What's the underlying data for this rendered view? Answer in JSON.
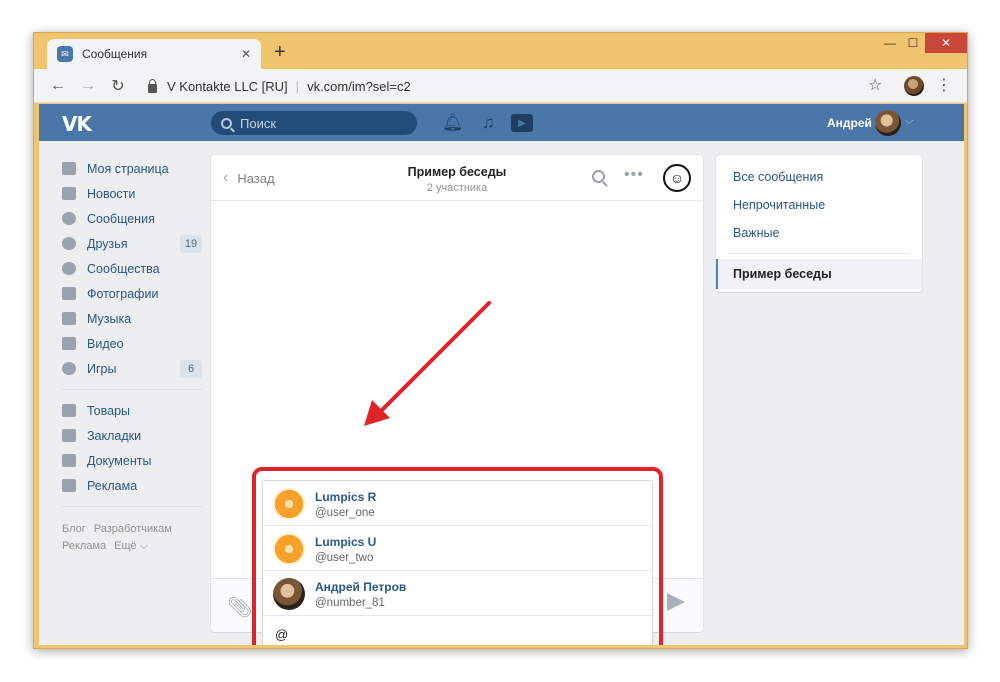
{
  "browser": {
    "tab_title": "Сообщения",
    "tab_close": "✕",
    "new_tab": "+",
    "site_owner": "V Kontakte LLC [RU]",
    "url": "vk.com/im?sel=c2",
    "window_buttons": {
      "minimize": "—",
      "maximize": "☐",
      "close": "✕"
    }
  },
  "header": {
    "logo": "VK",
    "search_placeholder": "Поиск",
    "username": "Андрей"
  },
  "sidebar": {
    "items": [
      {
        "label": "Моя страница",
        "icon": "home-icon"
      },
      {
        "label": "Новости",
        "icon": "news-icon"
      },
      {
        "label": "Сообщения",
        "icon": "messages-icon"
      },
      {
        "label": "Друзья",
        "icon": "friends-icon",
        "badge": "19"
      },
      {
        "label": "Сообщества",
        "icon": "communities-icon"
      },
      {
        "label": "Фотографии",
        "icon": "camera-icon"
      },
      {
        "label": "Музыка",
        "icon": "music-icon"
      },
      {
        "label": "Видео",
        "icon": "video-icon"
      },
      {
        "label": "Игры",
        "icon": "games-icon",
        "badge": "6"
      }
    ],
    "items2": [
      {
        "label": "Товары",
        "icon": "bag-icon"
      },
      {
        "label": "Закладки",
        "icon": "star-icon"
      },
      {
        "label": "Документы",
        "icon": "document-icon"
      },
      {
        "label": "Реклама",
        "icon": "megaphone-icon"
      }
    ],
    "footer": {
      "blog": "Блог",
      "developers": "Разработчикам",
      "ads": "Реклама",
      "more": "Ещё ⌵"
    }
  },
  "chat": {
    "back_label": "Назад",
    "title": "Пример беседы",
    "subtitle": "2 участника",
    "more": "•••",
    "mentions": [
      {
        "name": "Lumpics R",
        "handle": "@user_one",
        "avatar": "orange"
      },
      {
        "name": "Lumpics U",
        "handle": "@user_two",
        "avatar": "orange"
      },
      {
        "name": "Андрей Петров",
        "handle": "@number_81",
        "avatar": "photo"
      }
    ],
    "input_value": "@"
  },
  "right_nav": {
    "items": [
      "Все сообщения",
      "Непрочитанные",
      "Важные"
    ],
    "active": "Пример беседы"
  },
  "colors": {
    "vk_blue": "#4a76a8",
    "highlight_red": "#e0242a",
    "frame": "#f1c56f"
  }
}
